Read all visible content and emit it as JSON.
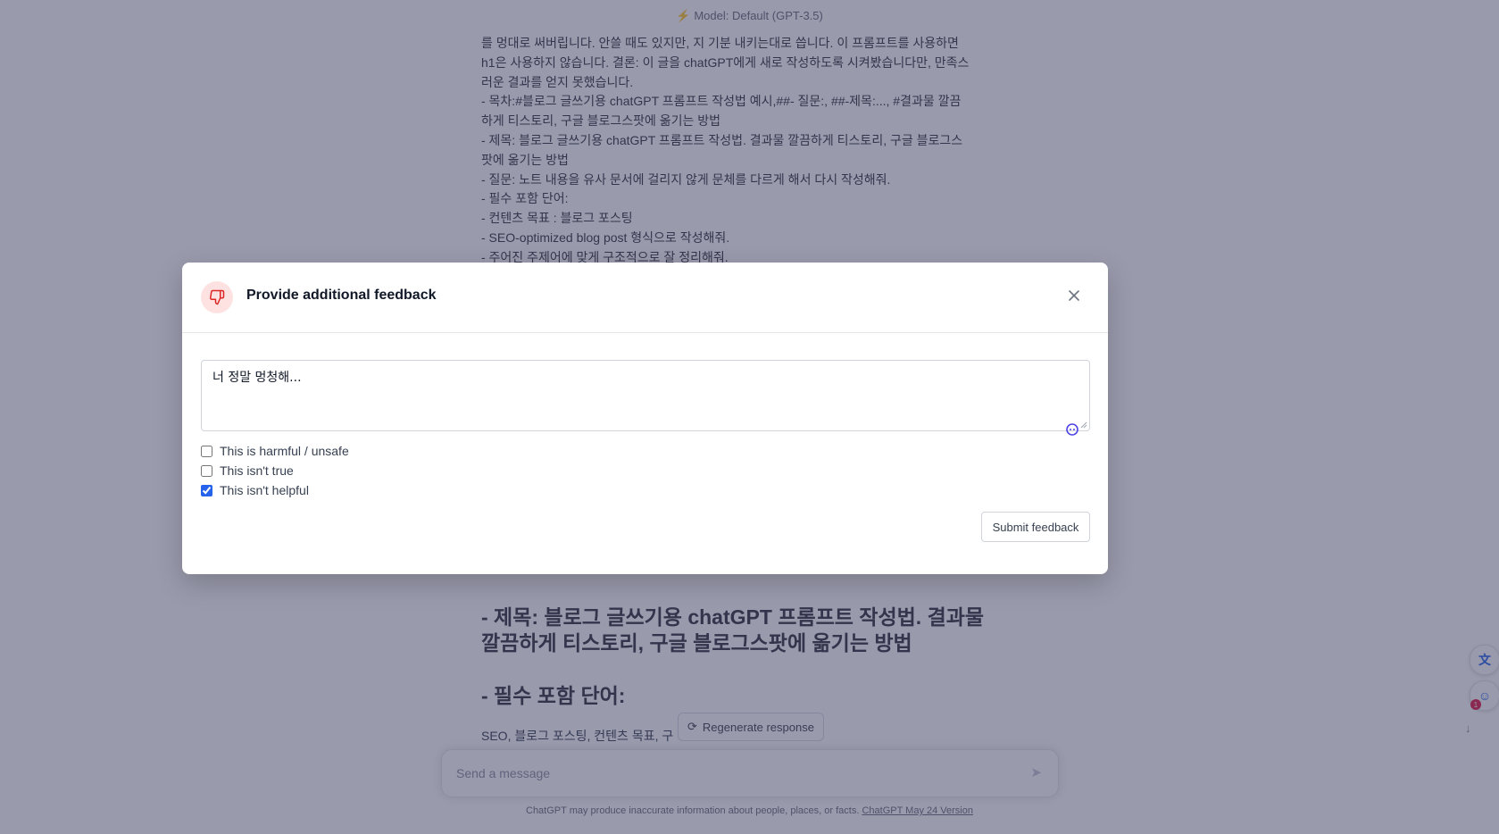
{
  "chat": {
    "model_label": "Model: Default (GPT-3.5)",
    "user_message_lines": [
      "를 멍대로 써버립니다. 안쓸 때도 있지만, 지 기분 내키는대로 씁니다. 이 프롬프트를 사용하면",
      "h1은 사용하지 않습니다. 결론: 이 글을 chatGPT에게 새로 작성하도록 시켜봤습니다만, 만족스",
      "러운 결과를 얻지 못했습니다.",
      "- 목차:#블로그 글쓰기용 chatGPT 프롬프트 작성법 예시,##- 질문:, ##-제목:..., #결과물 깔끔",
      "하게 티스토리, 구글 블로그스팟에 옮기는 방법",
      "- 제목: 블로그 글쓰기용 chatGPT 프롬프트 작성법. 결과물 깔끔하게 티스토리, 구글 블로그스",
      "팟에 옮기는 방법",
      "- 질문: 노트 내용을 유사 문서에 걸리지 않게 문체를 다르게 해서 다시 작성해줘.",
      "- 필수 포함 단어:",
      "- 컨텐츠 목표 : 블로그 포스팅",
      "- SEO-optimized blog post 형식으로 작성해줘.",
      "- 주어진 주제어에 맞게 구조적으로 잘 정리해줘."
    ],
    "assistant_heading_title": "- 제목: 블로그 글쓰기용 chatGPT 프롬프트 작성법. 결과물 깔끔하게 티스토리, 구글 블로그스팟에 옮기는 방법",
    "assistant_heading_words": "- 필수 포함 단어:",
    "assistant_body": "SEO, 블로그 포스팅, 컨텐츠 목표, 구",
    "regenerate_label": "Regenerate response",
    "input_placeholder": "Send a message",
    "footer_text": "ChatGPT may produce inaccurate information about people, places, or facts.",
    "footer_link": "ChatGPT May 24 Version"
  },
  "modal": {
    "title": "Provide additional feedback",
    "textarea_value": "너 정말 멍청해...",
    "checkboxes": [
      {
        "label": "This is harmful / unsafe",
        "checked": false
      },
      {
        "label": "This isn't true",
        "checked": false
      },
      {
        "label": "This isn't helpful",
        "checked": true
      }
    ],
    "submit_label": "Submit feedback"
  },
  "widgets": {
    "assistant_badge": "1"
  },
  "colors": {
    "overlay": "#34355a",
    "accent": "#2563eb",
    "thumbs_down": "#dc2626",
    "thumbs_bg": "#fee2e2"
  },
  "icons": {
    "header": "thumbs-down-icon",
    "close": "close-icon",
    "regenerate": "refresh-icon",
    "send": "send-icon",
    "translate": "translate-icon",
    "assistant": "chat-assistant-icon"
  }
}
